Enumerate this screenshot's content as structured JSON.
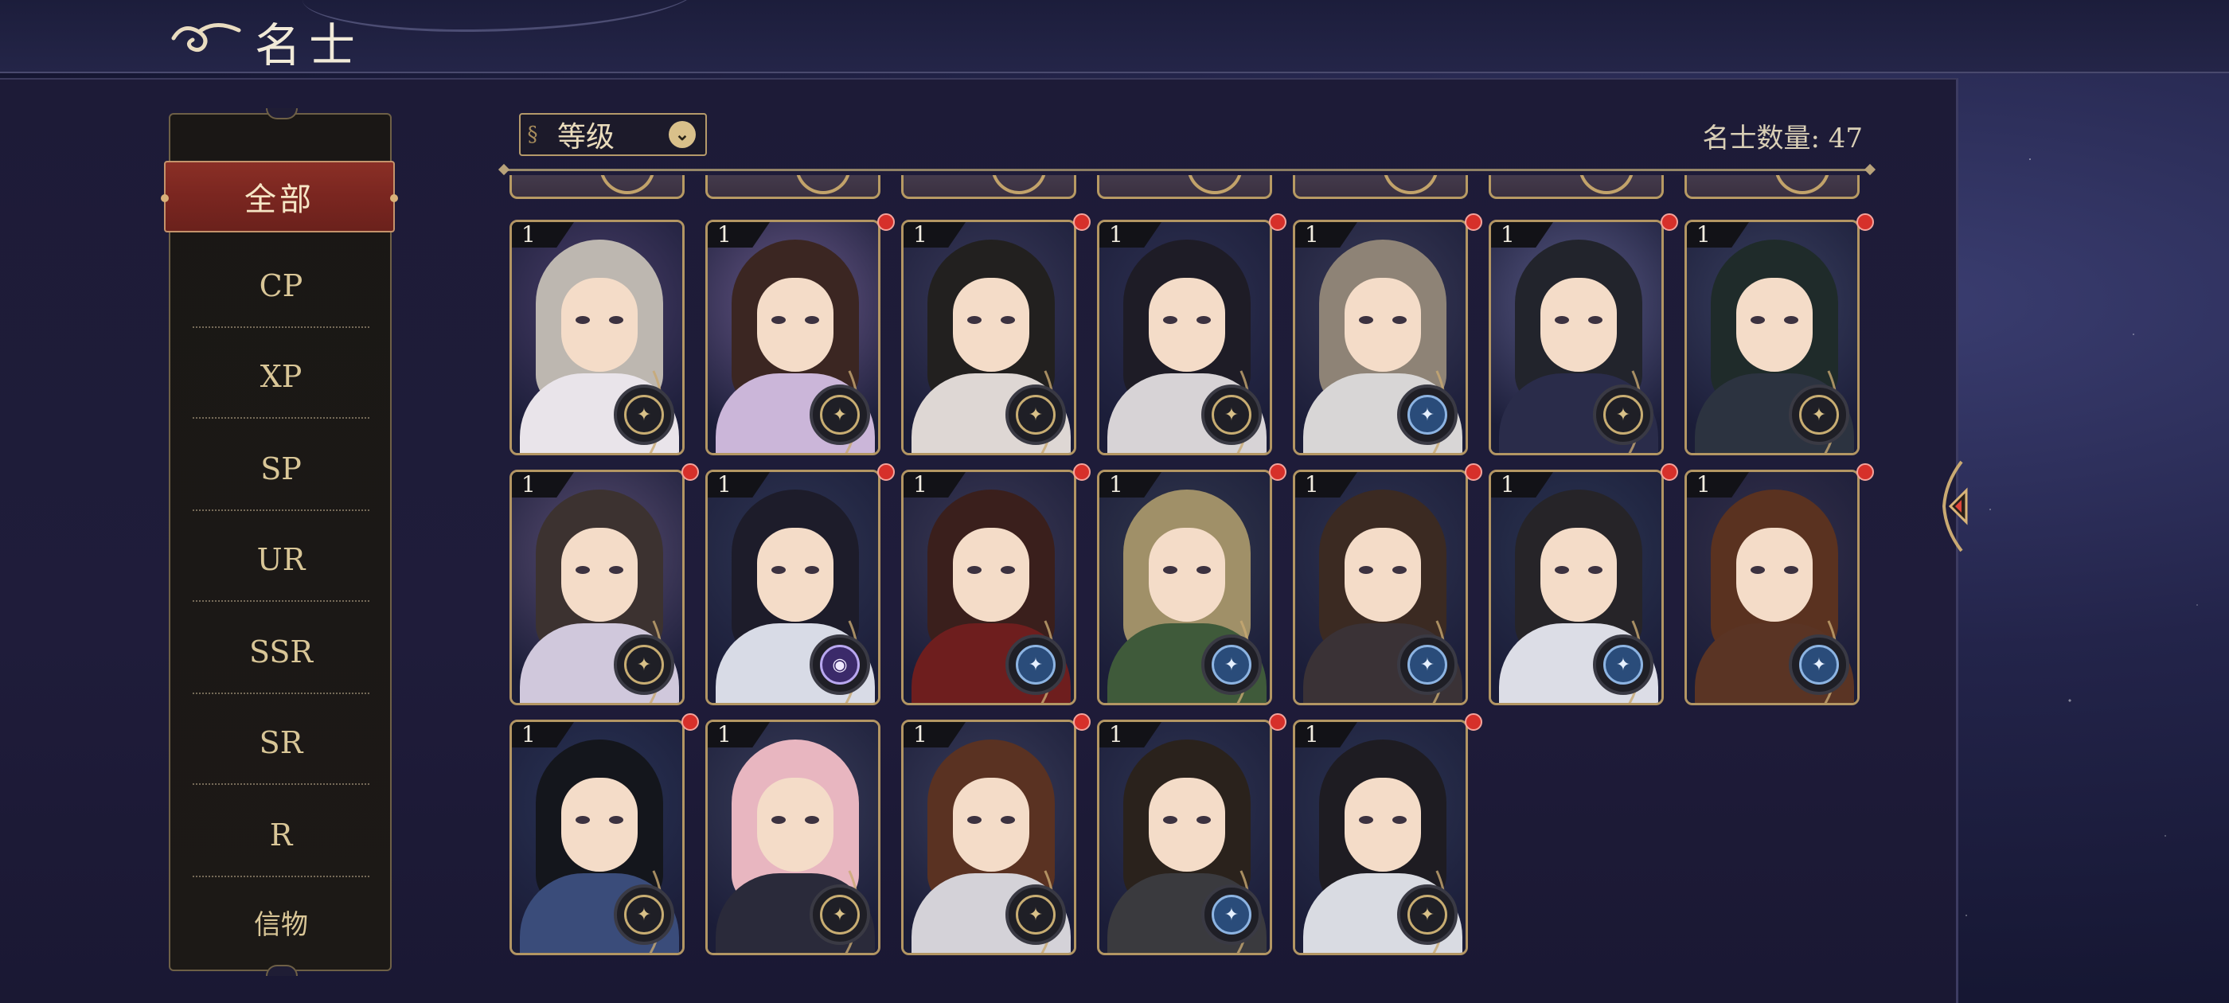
{
  "header": {
    "title": "名士"
  },
  "sidebar": {
    "active": "全部",
    "items": [
      "CP",
      "XP",
      "SP",
      "UR",
      "SSR",
      "SR",
      "R",
      "信物"
    ]
  },
  "toolbar": {
    "sort_label": "等级",
    "count_label": "名士数量: 47"
  },
  "colors": {
    "accent_gold": "#b39663",
    "active_tab": "#7a2620",
    "notification_dot": "#d6302a",
    "panel_bg": "#1d1b37"
  },
  "cards": [
    {
      "level": "1",
      "badge": "gold",
      "dot": false,
      "hair": "#bdb7b0",
      "bg": "#4a3f6a",
      "body": "#e9e4ea"
    },
    {
      "level": "1",
      "badge": "gold",
      "dot": true,
      "hair": "#3b2622",
      "bg": "#6a5a8a",
      "body": "#cbb6d9"
    },
    {
      "level": "1",
      "badge": "gold",
      "dot": true,
      "hair": "#22201f",
      "bg": "#3a3a5a",
      "body": "#ded7d4"
    },
    {
      "level": "1",
      "badge": "gold",
      "dot": true,
      "hair": "#1e1c26",
      "bg": "#2e3152",
      "body": "#d7d3d6"
    },
    {
      "level": "1",
      "badge": "blue",
      "dot": true,
      "hair": "#8e8376",
      "bg": "#3a3b58",
      "body": "#d8d6d6"
    },
    {
      "level": "1",
      "badge": "gold",
      "dot": true,
      "hair": "#22242c",
      "bg": "#5a5a86",
      "body": "#2a2c4a"
    },
    {
      "level": "1",
      "badge": "gold",
      "dot": true,
      "hair": "#1f2b2a",
      "bg": "#3a4060",
      "body": "#2c3340"
    },
    {
      "level": "1",
      "badge": "gold",
      "dot": true,
      "hair": "#3c3230",
      "bg": "#5b4f74",
      "body": "#d0c8dc"
    },
    {
      "level": "1",
      "badge": "purple",
      "dot": true,
      "hair": "#1d1c2a",
      "bg": "#2f3654",
      "body": "#d8dbe6"
    },
    {
      "level": "1",
      "badge": "blue",
      "dot": true,
      "hair": "#3a1f1c",
      "bg": "#3c3a56",
      "body": "#6e1e1e"
    },
    {
      "level": "1",
      "badge": "blue",
      "dot": true,
      "hair": "#a09068",
      "bg": "#32384e",
      "body": "#3f5a3a"
    },
    {
      "level": "1",
      "badge": "blue",
      "dot": true,
      "hair": "#3b2a22",
      "bg": "#2e3350",
      "body": "#3a3236"
    },
    {
      "level": "1",
      "badge": "blue",
      "dot": true,
      "hair": "#262428",
      "bg": "#2b3552",
      "body": "#dcdde6"
    },
    {
      "level": "1",
      "badge": "blue",
      "dot": true,
      "hair": "#5a3220",
      "bg": "#34304a",
      "body": "#5a3424"
    },
    {
      "level": "1",
      "badge": "gold",
      "dot": true,
      "hair": "#14161c",
      "bg": "#2a3456",
      "body": "#3a4c7a"
    },
    {
      "level": "1",
      "badge": "gold",
      "dot": false,
      "hair": "#e8b6c0",
      "bg": "#3a3e5a",
      "body": "#2a2a3a"
    },
    {
      "level": "1",
      "badge": "gold",
      "dot": true,
      "hair": "#5a3222",
      "bg": "#3a3d5a",
      "body": "#d4d2d8"
    },
    {
      "level": "1",
      "badge": "blue",
      "dot": true,
      "hair": "#2a221c",
      "bg": "#2e3452",
      "body": "#3a3a3e"
    },
    {
      "level": "1",
      "badge": "gold",
      "dot": true,
      "hair": "#1e1c22",
      "bg": "#2c3452",
      "body": "#d9dbe2"
    }
  ]
}
